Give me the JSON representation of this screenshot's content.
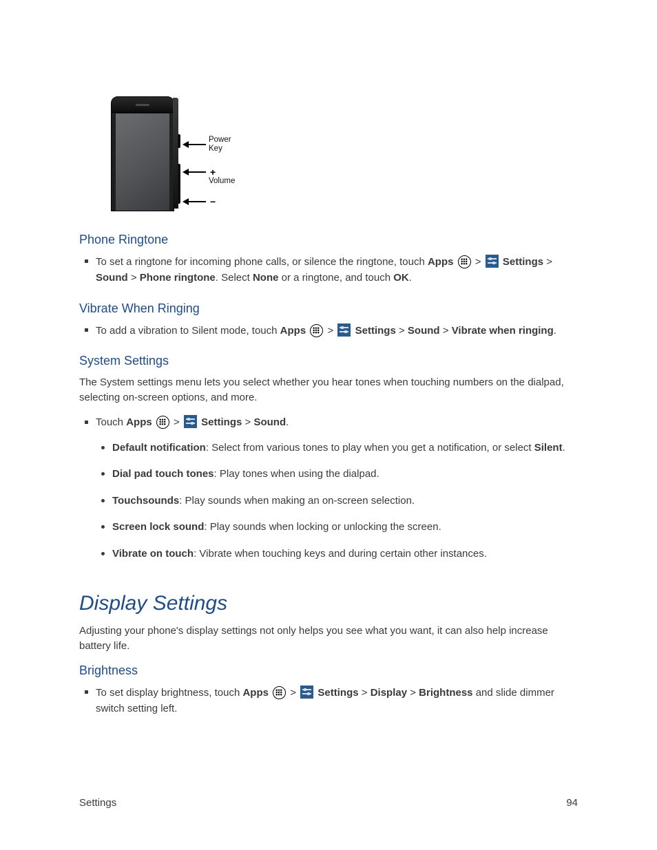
{
  "diagram": {
    "power_label": "Power\nKey",
    "volume_label": "Volume",
    "plus": "+",
    "minus": "−"
  },
  "sections": {
    "phone_ringtone": {
      "heading": "Phone Ringtone",
      "bullet": {
        "pre": "To set a ringtone for incoming phone calls, or silence the ringtone, touch ",
        "apps": "Apps",
        "gt1": " > ",
        "line2a": "Settings",
        "sep2": " > ",
        "sound": "Sound",
        "sep3": " > ",
        "phone_ringtone": "Phone ringtone",
        "mid": ". Select ",
        "none": "None",
        "mid2": " or a ringtone, and touch ",
        "ok": "OK",
        "end": "."
      }
    },
    "vibrate": {
      "heading": "Vibrate When Ringing",
      "bullet": {
        "pre": "To add a vibration to Silent mode, touch ",
        "apps": "Apps",
        "gt1": " > ",
        "settings": "Settings",
        "sep2": " > ",
        "sound": "Sound",
        "sep3": " > ",
        "vibrate_when_ringing": "Vibrate when ringing",
        "end": "."
      }
    },
    "system": {
      "heading": "System Settings",
      "intro": "The System settings menu lets you select whether you hear tones when touching numbers on the dialpad, selecting on-screen options, and more.",
      "touch_line": {
        "pre": "Touch ",
        "apps": "Apps",
        "gt1": " > ",
        "settings": "Settings",
        "sep2": " > ",
        "sound": "Sound",
        "end": "."
      },
      "subitems": {
        "default_notification": {
          "label": "Default notification",
          "desc": ": Select from various tones to play when you get a notification, or select ",
          "silent": "Silent",
          "end": "."
        },
        "dial_pad": {
          "label": "Dial pad touch tones",
          "desc": ": Play tones when using the dialpad."
        },
        "touchsounds": {
          "label": "Touchsounds",
          "desc": ": Play sounds when making an on-screen selection."
        },
        "screen_lock": {
          "label": "Screen lock sound",
          "desc": ": Play sounds when locking or unlocking the screen."
        },
        "vibrate_on_touch": {
          "label": "Vibrate on touch",
          "desc": ": Vibrate when touching keys and during certain other instances."
        }
      }
    },
    "display": {
      "heading": "Display Settings",
      "intro": "Adjusting your phone's display settings not only helps you see what you want, it can also help increase battery life."
    },
    "brightness": {
      "heading": "Brightness",
      "bullet": {
        "pre": "To set display brightness, touch ",
        "apps": "Apps",
        "gt1": " > ",
        "settings": "Settings",
        "sep2": " > ",
        "display": "Display",
        "sep3": " > ",
        "brightness": "Brightness",
        "tail": " and slide dimmer switch setting left."
      }
    }
  },
  "footer": {
    "section": "Settings",
    "page": "94"
  }
}
